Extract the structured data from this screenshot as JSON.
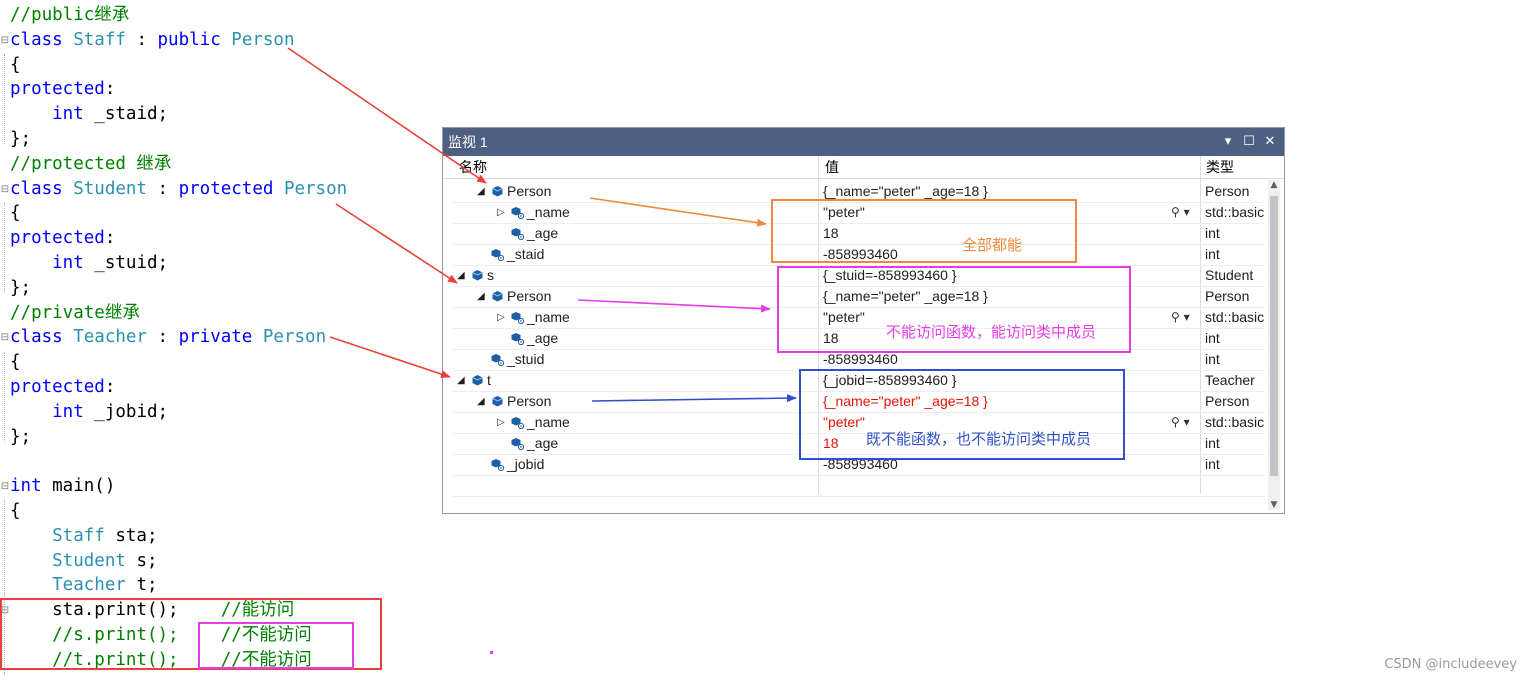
{
  "code": {
    "lines": [
      {
        "segments": [
          {
            "text": "//public继承",
            "cls": "c"
          }
        ]
      },
      {
        "fold": "⊟",
        "segments": [
          {
            "text": "class ",
            "cls": "k"
          },
          {
            "text": "Staff",
            "cls": "t"
          },
          {
            "text": " : ",
            "cls": "p"
          },
          {
            "text": "public ",
            "cls": "k"
          },
          {
            "text": "Person",
            "cls": "t"
          }
        ]
      },
      {
        "segments": [
          {
            "text": "{",
            "cls": "p"
          }
        ]
      },
      {
        "segments": [
          {
            "text": "protected",
            "cls": "k"
          },
          {
            "text": ":",
            "cls": "p"
          }
        ]
      },
      {
        "segments": [
          {
            "text": "    int",
            "cls": "k"
          },
          {
            "text": " _staid;",
            "cls": "p"
          }
        ]
      },
      {
        "segments": [
          {
            "text": "};",
            "cls": "p"
          }
        ]
      },
      {
        "segments": [
          {
            "text": "//protected 继承",
            "cls": "c"
          }
        ]
      },
      {
        "fold": "⊟",
        "segments": [
          {
            "text": "class ",
            "cls": "k"
          },
          {
            "text": "Student",
            "cls": "t"
          },
          {
            "text": " : ",
            "cls": "p"
          },
          {
            "text": "protected ",
            "cls": "k"
          },
          {
            "text": "Person",
            "cls": "t"
          }
        ]
      },
      {
        "segments": [
          {
            "text": "{",
            "cls": "p"
          }
        ]
      },
      {
        "segments": [
          {
            "text": "protected",
            "cls": "k"
          },
          {
            "text": ":",
            "cls": "p"
          }
        ]
      },
      {
        "segments": [
          {
            "text": "    int",
            "cls": "k"
          },
          {
            "text": " _stuid;",
            "cls": "p"
          }
        ]
      },
      {
        "segments": [
          {
            "text": "};",
            "cls": "p"
          }
        ]
      },
      {
        "segments": [
          {
            "text": "//private继承",
            "cls": "c"
          }
        ]
      },
      {
        "fold": "⊟",
        "segments": [
          {
            "text": "class ",
            "cls": "k"
          },
          {
            "text": "Teacher",
            "cls": "t"
          },
          {
            "text": " : ",
            "cls": "p"
          },
          {
            "text": "private ",
            "cls": "k"
          },
          {
            "text": "Person",
            "cls": "t"
          }
        ]
      },
      {
        "segments": [
          {
            "text": "{",
            "cls": "p"
          }
        ]
      },
      {
        "segments": [
          {
            "text": "protected",
            "cls": "k"
          },
          {
            "text": ":",
            "cls": "p"
          }
        ]
      },
      {
        "segments": [
          {
            "text": "    int",
            "cls": "k"
          },
          {
            "text": " _jobid;",
            "cls": "p"
          }
        ]
      },
      {
        "segments": [
          {
            "text": "};",
            "cls": "p"
          }
        ]
      },
      {
        "segments": []
      },
      {
        "fold": "⊟",
        "segments": [
          {
            "text": "int",
            "cls": "k"
          },
          {
            "text": " main()",
            "cls": "p"
          }
        ]
      },
      {
        "segments": [
          {
            "text": "{",
            "cls": "p"
          }
        ]
      },
      {
        "segments": [
          {
            "text": "    Staff",
            "cls": "t"
          },
          {
            "text": " sta;",
            "cls": "p"
          }
        ]
      },
      {
        "segments": [
          {
            "text": "    Student",
            "cls": "t"
          },
          {
            "text": " s;",
            "cls": "p"
          }
        ]
      },
      {
        "segments": [
          {
            "text": "    Teacher",
            "cls": "t"
          },
          {
            "text": " t;",
            "cls": "p"
          }
        ]
      },
      {
        "fold": "⊟",
        "segments": [
          {
            "text": "    sta.print();    ",
            "cls": "p"
          },
          {
            "text": "//能访问",
            "cls": "c"
          }
        ]
      },
      {
        "segments": [
          {
            "text": "    //s.print();    //不能访问",
            "cls": "c"
          }
        ]
      },
      {
        "segments": [
          {
            "text": "    //t.print();    //不能访问",
            "cls": "c"
          }
        ]
      }
    ]
  },
  "watch": {
    "title": "监视 1",
    "icons": {
      "dropdown": "▾",
      "maximize": "☐",
      "close": "✕"
    },
    "columns": {
      "name": "名称",
      "value": "值",
      "type": "类型"
    },
    "rows": [
      {
        "level": 1,
        "expander": "◢",
        "icon": "class",
        "name": "Person",
        "value": "{_name=\"peter\" _age=18 }",
        "type": "Person"
      },
      {
        "level": 2,
        "expander": "▷",
        "icon": "field",
        "name": "_name",
        "value": "\"peter\"",
        "type": "std::basic",
        "search": true
      },
      {
        "level": 2,
        "expander": "",
        "icon": "field",
        "name": "_age",
        "value": "18",
        "type": "int"
      },
      {
        "level": 1,
        "expander": "",
        "icon": "field",
        "name": "_staid",
        "value": "-858993460",
        "type": "int"
      },
      {
        "level": 0,
        "expander": "◢",
        "icon": "class",
        "name": "s",
        "value": "{_stuid=-858993460 }",
        "type": "Student"
      },
      {
        "level": 1,
        "expander": "◢",
        "icon": "class",
        "name": "Person",
        "value": "{_name=\"peter\" _age=18 }",
        "type": "Person"
      },
      {
        "level": 2,
        "expander": "▷",
        "icon": "field",
        "name": "_name",
        "value": "\"peter\"",
        "type": "std::basic",
        "search": true
      },
      {
        "level": 2,
        "expander": "",
        "icon": "field",
        "name": "_age",
        "value": "18",
        "type": "int"
      },
      {
        "level": 1,
        "expander": "",
        "icon": "field",
        "name": "_stuid",
        "value": "-858993460",
        "type": "int"
      },
      {
        "level": 0,
        "expander": "◢",
        "icon": "class",
        "name": "t",
        "value": "{_jobid=-858993460 }",
        "type": "Teacher"
      },
      {
        "level": 1,
        "expander": "◢",
        "icon": "class",
        "name": "Person",
        "value": "{_name=\"peter\" _age=18 }",
        "type": "Person",
        "red": true
      },
      {
        "level": 2,
        "expander": "▷",
        "icon": "field",
        "name": "_name",
        "value": "\"peter\"",
        "type": "std::basic",
        "search": true,
        "red": true
      },
      {
        "level": 2,
        "expander": "",
        "icon": "field",
        "name": "_age",
        "value": "18",
        "type": "int",
        "red": true
      },
      {
        "level": 1,
        "expander": "",
        "icon": "field",
        "name": "_jobid",
        "value": "-858993460",
        "type": "int"
      }
    ]
  },
  "annotations": {
    "staff_note": "全部都能",
    "student_note": "不能访问函数，能访问类中成员",
    "teacher_note": "既不能函数，也不能访问类中成员",
    "colors": {
      "red": "#e8403a",
      "orange": "#f0883a",
      "magenta": "#e53de5",
      "blue": "#3150c8"
    }
  },
  "watermark": "CSDN @includeevey"
}
